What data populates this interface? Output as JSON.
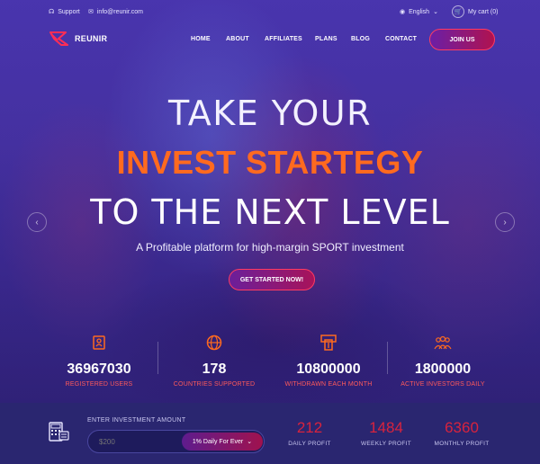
{
  "topbar": {
    "support_label": "Support",
    "email": "info@reunir.com",
    "language": "English",
    "cart_label": "My cart (0)"
  },
  "brand": {
    "name": "REUNIR"
  },
  "nav": {
    "items": [
      "HOME",
      "ABOUT",
      "AFFILIATES",
      "PLANS",
      "BLOG",
      "CONTACT"
    ],
    "join_label": "JOIN US"
  },
  "hero": {
    "line1": "TAKE YOUR",
    "line2": "INVEST STARTEGY",
    "line3": "TO THE NEXT LEVEL",
    "tagline": "A Profitable platform for high-margin SPORT investment",
    "cta_label": "GET STARTED NOW!"
  },
  "stats": [
    {
      "icon": "users-icon",
      "value": "36967030",
      "label": "REGISTERED USERS"
    },
    {
      "icon": "globe-icon",
      "value": "178",
      "label": "COUNTRIES SUPPORTED"
    },
    {
      "icon": "withdraw-icon",
      "value": "10800000",
      "label": "WITHDRAWN EACH MONTH"
    },
    {
      "icon": "investors-icon",
      "value": "1800000",
      "label": "ACTIVE INVESTORS DAILY"
    }
  ],
  "calculator": {
    "label": "ENTER INVESTMENT AMOUNT",
    "placeholder": "$200",
    "plan_selected": "1% Daily For Ever",
    "profits": [
      {
        "value": "212",
        "label": "DAILY PROFIT"
      },
      {
        "value": "1484",
        "label": "WEEKLY PROFIT"
      },
      {
        "value": "6360",
        "label": "MONTHLY PROFIT"
      }
    ]
  },
  "colors": {
    "accent_orange": "#ff6a1f",
    "accent_red": "#ff3b62",
    "stat_label": "#ff5a5a",
    "profit_value": "#d8233d",
    "hero_bg": "#4a35a8",
    "bottom_bar": "#2a2670"
  }
}
